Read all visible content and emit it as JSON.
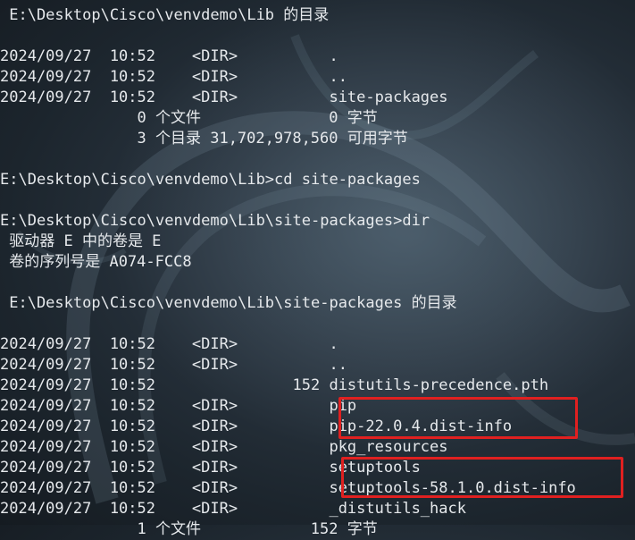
{
  "terminal": {
    "lines": [
      " E:\\Desktop\\Cisco\\venvdemo\\Lib 的目录",
      "",
      "2024/09/27  10:52    <DIR>          .",
      "2024/09/27  10:52    <DIR>          ..",
      "2024/09/27  10:52    <DIR>          site-packages",
      "               0 个文件              0 字节",
      "               3 个目录 31,702,978,560 可用字节",
      "",
      "E:\\Desktop\\Cisco\\venvdemo\\Lib>cd site-packages",
      "",
      "E:\\Desktop\\Cisco\\venvdemo\\Lib\\site-packages>dir",
      " 驱动器 E 中的卷是 E",
      " 卷的序列号是 A074-FCC8",
      "",
      " E:\\Desktop\\Cisco\\venvdemo\\Lib\\site-packages 的目录",
      "",
      "2024/09/27  10:52    <DIR>          .",
      "2024/09/27  10:52    <DIR>          ..",
      "2024/09/27  10:52               152 distutils-precedence.pth",
      "2024/09/27  10:52    <DIR>          pip",
      "2024/09/27  10:52    <DIR>          pip-22.0.4.dist-info",
      "2024/09/27  10:52    <DIR>          pkg_resources",
      "2024/09/27  10:52    <DIR>          setuptools",
      "2024/09/27  10:52    <DIR>          setuptools-58.1.0.dist-info",
      "2024/09/27  10:52    <DIR>          _distutils_hack",
      "               1 个文件            152 字节"
    ]
  },
  "colors": {
    "text": "#e6e9ec",
    "highlight": "#e02020",
    "background": "#1c252d"
  }
}
